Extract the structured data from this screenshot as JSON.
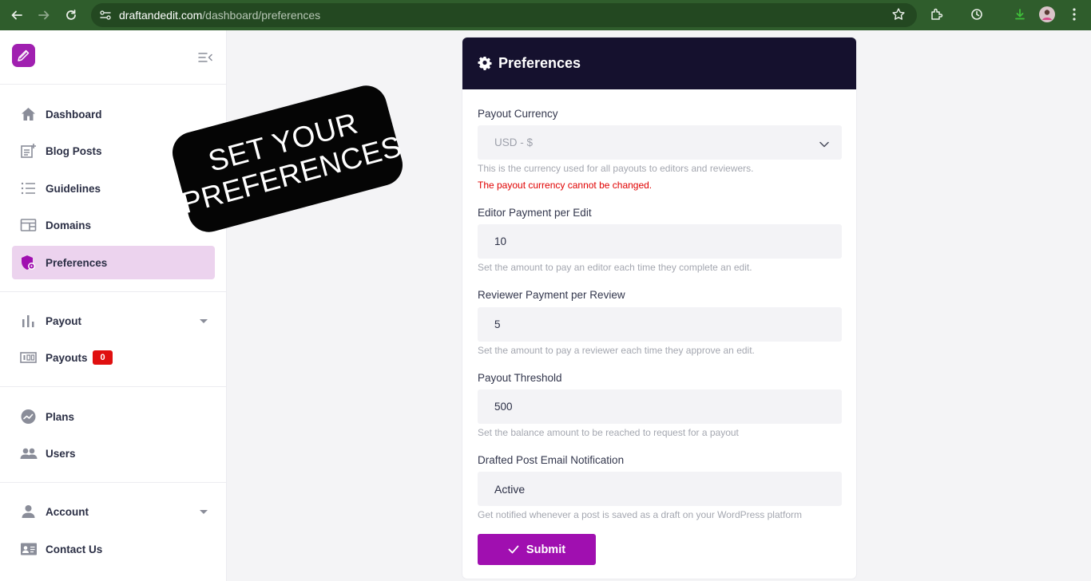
{
  "browser": {
    "url_host": "draftandedit.com",
    "url_path": "/dashboard/preferences"
  },
  "sidebar": {
    "groups": [
      [
        {
          "label": "Dashboard",
          "icon": "home-icon"
        },
        {
          "label": "Blog Posts",
          "icon": "post-add-icon"
        },
        {
          "label": "Guidelines",
          "icon": "list-icon"
        },
        {
          "label": "Domains",
          "icon": "web-icon"
        },
        {
          "label": "Preferences",
          "icon": "shield-settings-icon",
          "active": true
        }
      ],
      [
        {
          "label": "Payout",
          "icon": "bar-chart-icon",
          "expandable": true
        },
        {
          "label": "Payouts",
          "icon": "money-icon",
          "badge": "0"
        }
      ],
      [
        {
          "label": "Plans",
          "icon": "plans-icon"
        },
        {
          "label": "Users",
          "icon": "people-icon"
        }
      ],
      [
        {
          "label": "Account",
          "icon": "person-icon",
          "expandable": true
        },
        {
          "label": "Contact Us",
          "icon": "contact-card-icon"
        }
      ]
    ]
  },
  "overlay": {
    "line1": "SET YOUR",
    "line2": "PREFERENCES"
  },
  "card": {
    "title": "Preferences",
    "payout_currency": {
      "label": "Payout Currency",
      "value": "USD - $",
      "help": "This is the currency used for all payouts to editors and reviewers.",
      "error": "The payout currency cannot be changed."
    },
    "editor_payment": {
      "label": "Editor Payment per Edit",
      "value": "10",
      "help": "Set the amount to pay an editor each time they complete an edit."
    },
    "reviewer_payment": {
      "label": "Reviewer Payment per Review",
      "value": "5",
      "help": "Set the amount to pay a reviewer each time they approve an edit."
    },
    "payout_threshold": {
      "label": "Payout Threshold",
      "value": "500",
      "help": "Set the balance amount to be reached to request for a payout"
    },
    "draft_notification": {
      "label": "Drafted Post Email Notification",
      "value": "Active",
      "help": "Get notified whenever a post is saved as a draft on your WordPress platform"
    },
    "submit_label": "Submit"
  },
  "colors": {
    "accent": "#a00fb0",
    "header": "#15112e",
    "active_nav": "#ecd3ee",
    "error": "#e00000",
    "badge": "#e01010"
  }
}
